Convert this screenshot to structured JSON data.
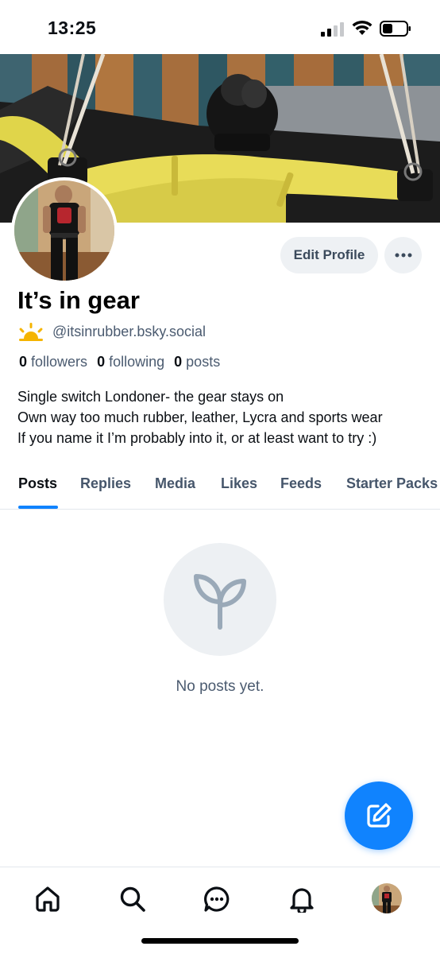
{
  "status_bar": {
    "time": "13:25",
    "signal_icon": "cellular-signal-icon",
    "wifi_icon": "wifi-icon",
    "battery_icon": "battery-icon"
  },
  "profile": {
    "display_name": "It’s in gear",
    "handle": "@itsinrubber.bsky.social",
    "handle_icon": "sunrise-emoji-icon",
    "stats": {
      "followers_count": "0",
      "followers_label": "followers",
      "following_count": "0",
      "following_label": "following",
      "posts_count": "0",
      "posts_label": "posts"
    },
    "bio": [
      "Single switch Londoner- the gear stays on",
      "Own way too much rubber, leather, Lycra and sports wear",
      "If you name it I’m probably into it, or at least want to try :)"
    ],
    "edit_label": "Edit Profile",
    "more_icon": "ellipsis-icon"
  },
  "tabs": [
    {
      "label": "Posts",
      "active": true
    },
    {
      "label": "Replies",
      "active": false
    },
    {
      "label": "Media",
      "active": false
    },
    {
      "label": "Likes",
      "active": false
    },
    {
      "label": "Feeds",
      "active": false
    },
    {
      "label": "Starter Packs",
      "active": false
    }
  ],
  "empty_state": {
    "icon": "sprout-icon",
    "text": "No posts yet."
  },
  "fab": {
    "icon": "compose-icon"
  },
  "bottom_nav": [
    {
      "icon": "home-icon"
    },
    {
      "icon": "search-icon"
    },
    {
      "icon": "chat-icon"
    },
    {
      "icon": "bell-icon"
    },
    {
      "icon": "profile-avatar"
    }
  ],
  "colors": {
    "accent": "#1083fe",
    "text_primary": "#0b0f14",
    "text_secondary": "#4b5b70",
    "button_bg": "#eef1f4",
    "empty_bg": "#edf0f3",
    "icon_muted": "#9aa9b8"
  }
}
